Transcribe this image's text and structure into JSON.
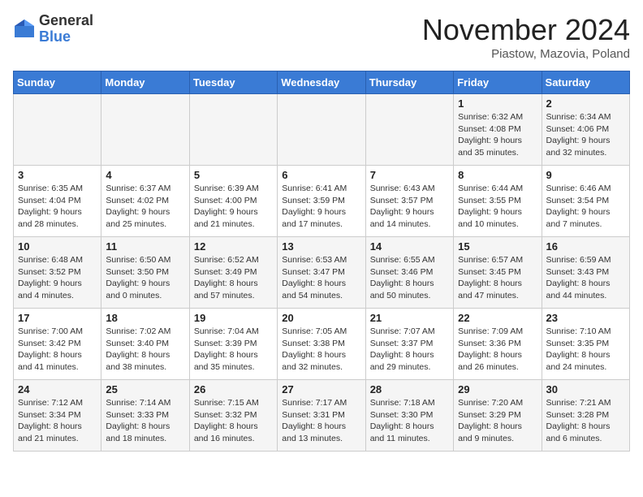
{
  "logo": {
    "general": "General",
    "blue": "Blue"
  },
  "title": "November 2024",
  "location": "Piastow, Mazovia, Poland",
  "days_of_week": [
    "Sunday",
    "Monday",
    "Tuesday",
    "Wednesday",
    "Thursday",
    "Friday",
    "Saturday"
  ],
  "weeks": [
    [
      {
        "day": "",
        "info": ""
      },
      {
        "day": "",
        "info": ""
      },
      {
        "day": "",
        "info": ""
      },
      {
        "day": "",
        "info": ""
      },
      {
        "day": "",
        "info": ""
      },
      {
        "day": "1",
        "info": "Sunrise: 6:32 AM\nSunset: 4:08 PM\nDaylight: 9 hours and 35 minutes."
      },
      {
        "day": "2",
        "info": "Sunrise: 6:34 AM\nSunset: 4:06 PM\nDaylight: 9 hours and 32 minutes."
      }
    ],
    [
      {
        "day": "3",
        "info": "Sunrise: 6:35 AM\nSunset: 4:04 PM\nDaylight: 9 hours and 28 minutes."
      },
      {
        "day": "4",
        "info": "Sunrise: 6:37 AM\nSunset: 4:02 PM\nDaylight: 9 hours and 25 minutes."
      },
      {
        "day": "5",
        "info": "Sunrise: 6:39 AM\nSunset: 4:00 PM\nDaylight: 9 hours and 21 minutes."
      },
      {
        "day": "6",
        "info": "Sunrise: 6:41 AM\nSunset: 3:59 PM\nDaylight: 9 hours and 17 minutes."
      },
      {
        "day": "7",
        "info": "Sunrise: 6:43 AM\nSunset: 3:57 PM\nDaylight: 9 hours and 14 minutes."
      },
      {
        "day": "8",
        "info": "Sunrise: 6:44 AM\nSunset: 3:55 PM\nDaylight: 9 hours and 10 minutes."
      },
      {
        "day": "9",
        "info": "Sunrise: 6:46 AM\nSunset: 3:54 PM\nDaylight: 9 hours and 7 minutes."
      }
    ],
    [
      {
        "day": "10",
        "info": "Sunrise: 6:48 AM\nSunset: 3:52 PM\nDaylight: 9 hours and 4 minutes."
      },
      {
        "day": "11",
        "info": "Sunrise: 6:50 AM\nSunset: 3:50 PM\nDaylight: 9 hours and 0 minutes."
      },
      {
        "day": "12",
        "info": "Sunrise: 6:52 AM\nSunset: 3:49 PM\nDaylight: 8 hours and 57 minutes."
      },
      {
        "day": "13",
        "info": "Sunrise: 6:53 AM\nSunset: 3:47 PM\nDaylight: 8 hours and 54 minutes."
      },
      {
        "day": "14",
        "info": "Sunrise: 6:55 AM\nSunset: 3:46 PM\nDaylight: 8 hours and 50 minutes."
      },
      {
        "day": "15",
        "info": "Sunrise: 6:57 AM\nSunset: 3:45 PM\nDaylight: 8 hours and 47 minutes."
      },
      {
        "day": "16",
        "info": "Sunrise: 6:59 AM\nSunset: 3:43 PM\nDaylight: 8 hours and 44 minutes."
      }
    ],
    [
      {
        "day": "17",
        "info": "Sunrise: 7:00 AM\nSunset: 3:42 PM\nDaylight: 8 hours and 41 minutes."
      },
      {
        "day": "18",
        "info": "Sunrise: 7:02 AM\nSunset: 3:40 PM\nDaylight: 8 hours and 38 minutes."
      },
      {
        "day": "19",
        "info": "Sunrise: 7:04 AM\nSunset: 3:39 PM\nDaylight: 8 hours and 35 minutes."
      },
      {
        "day": "20",
        "info": "Sunrise: 7:05 AM\nSunset: 3:38 PM\nDaylight: 8 hours and 32 minutes."
      },
      {
        "day": "21",
        "info": "Sunrise: 7:07 AM\nSunset: 3:37 PM\nDaylight: 8 hours and 29 minutes."
      },
      {
        "day": "22",
        "info": "Sunrise: 7:09 AM\nSunset: 3:36 PM\nDaylight: 8 hours and 26 minutes."
      },
      {
        "day": "23",
        "info": "Sunrise: 7:10 AM\nSunset: 3:35 PM\nDaylight: 8 hours and 24 minutes."
      }
    ],
    [
      {
        "day": "24",
        "info": "Sunrise: 7:12 AM\nSunset: 3:34 PM\nDaylight: 8 hours and 21 minutes."
      },
      {
        "day": "25",
        "info": "Sunrise: 7:14 AM\nSunset: 3:33 PM\nDaylight: 8 hours and 18 minutes."
      },
      {
        "day": "26",
        "info": "Sunrise: 7:15 AM\nSunset: 3:32 PM\nDaylight: 8 hours and 16 minutes."
      },
      {
        "day": "27",
        "info": "Sunrise: 7:17 AM\nSunset: 3:31 PM\nDaylight: 8 hours and 13 minutes."
      },
      {
        "day": "28",
        "info": "Sunrise: 7:18 AM\nSunset: 3:30 PM\nDaylight: 8 hours and 11 minutes."
      },
      {
        "day": "29",
        "info": "Sunrise: 7:20 AM\nSunset: 3:29 PM\nDaylight: 8 hours and 9 minutes."
      },
      {
        "day": "30",
        "info": "Sunrise: 7:21 AM\nSunset: 3:28 PM\nDaylight: 8 hours and 6 minutes."
      }
    ]
  ]
}
